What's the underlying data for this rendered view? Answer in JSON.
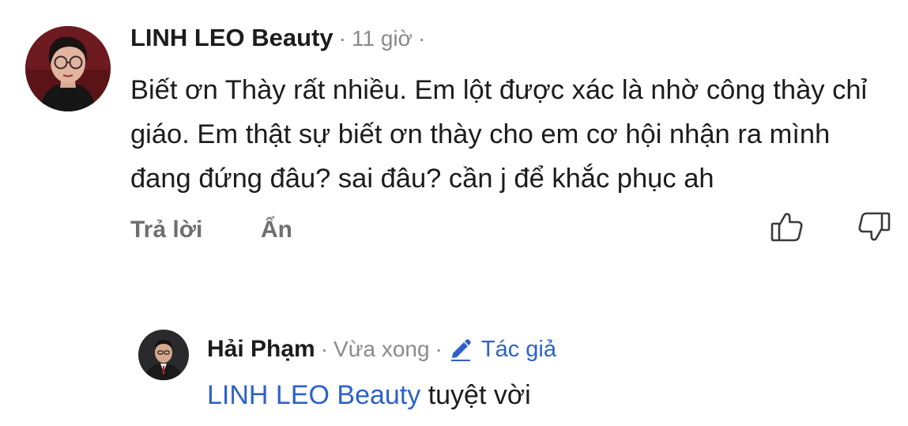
{
  "comment": {
    "author": "LINH LEO Beauty",
    "separator": "·",
    "time": "11 giờ",
    "text": "Biết ơn Thày rất nhiều. Em lột được xác là nhờ công thày chỉ giáo. Em thật sự biết ơn thày cho em cơ hội nhận ra mình đang đứng đâu? sai đâu? cần j để khắc phục ah",
    "actions": {
      "reply": "Trả lời",
      "hide": "Ẩn"
    },
    "icons": {
      "like": "thumbs-up-icon",
      "dislike": "thumbs-down-icon"
    }
  },
  "reply": {
    "author": "Hải Phạm",
    "separator": "·",
    "time": "Vừa xong",
    "badge": "Tác giả",
    "mention": "LINH LEO Beauty",
    "text": "tuyệt vời"
  },
  "colors": {
    "link_blue": "#2d62c8",
    "meta_gray": "#8a8a8e",
    "text_dark": "#1c1c1e"
  }
}
